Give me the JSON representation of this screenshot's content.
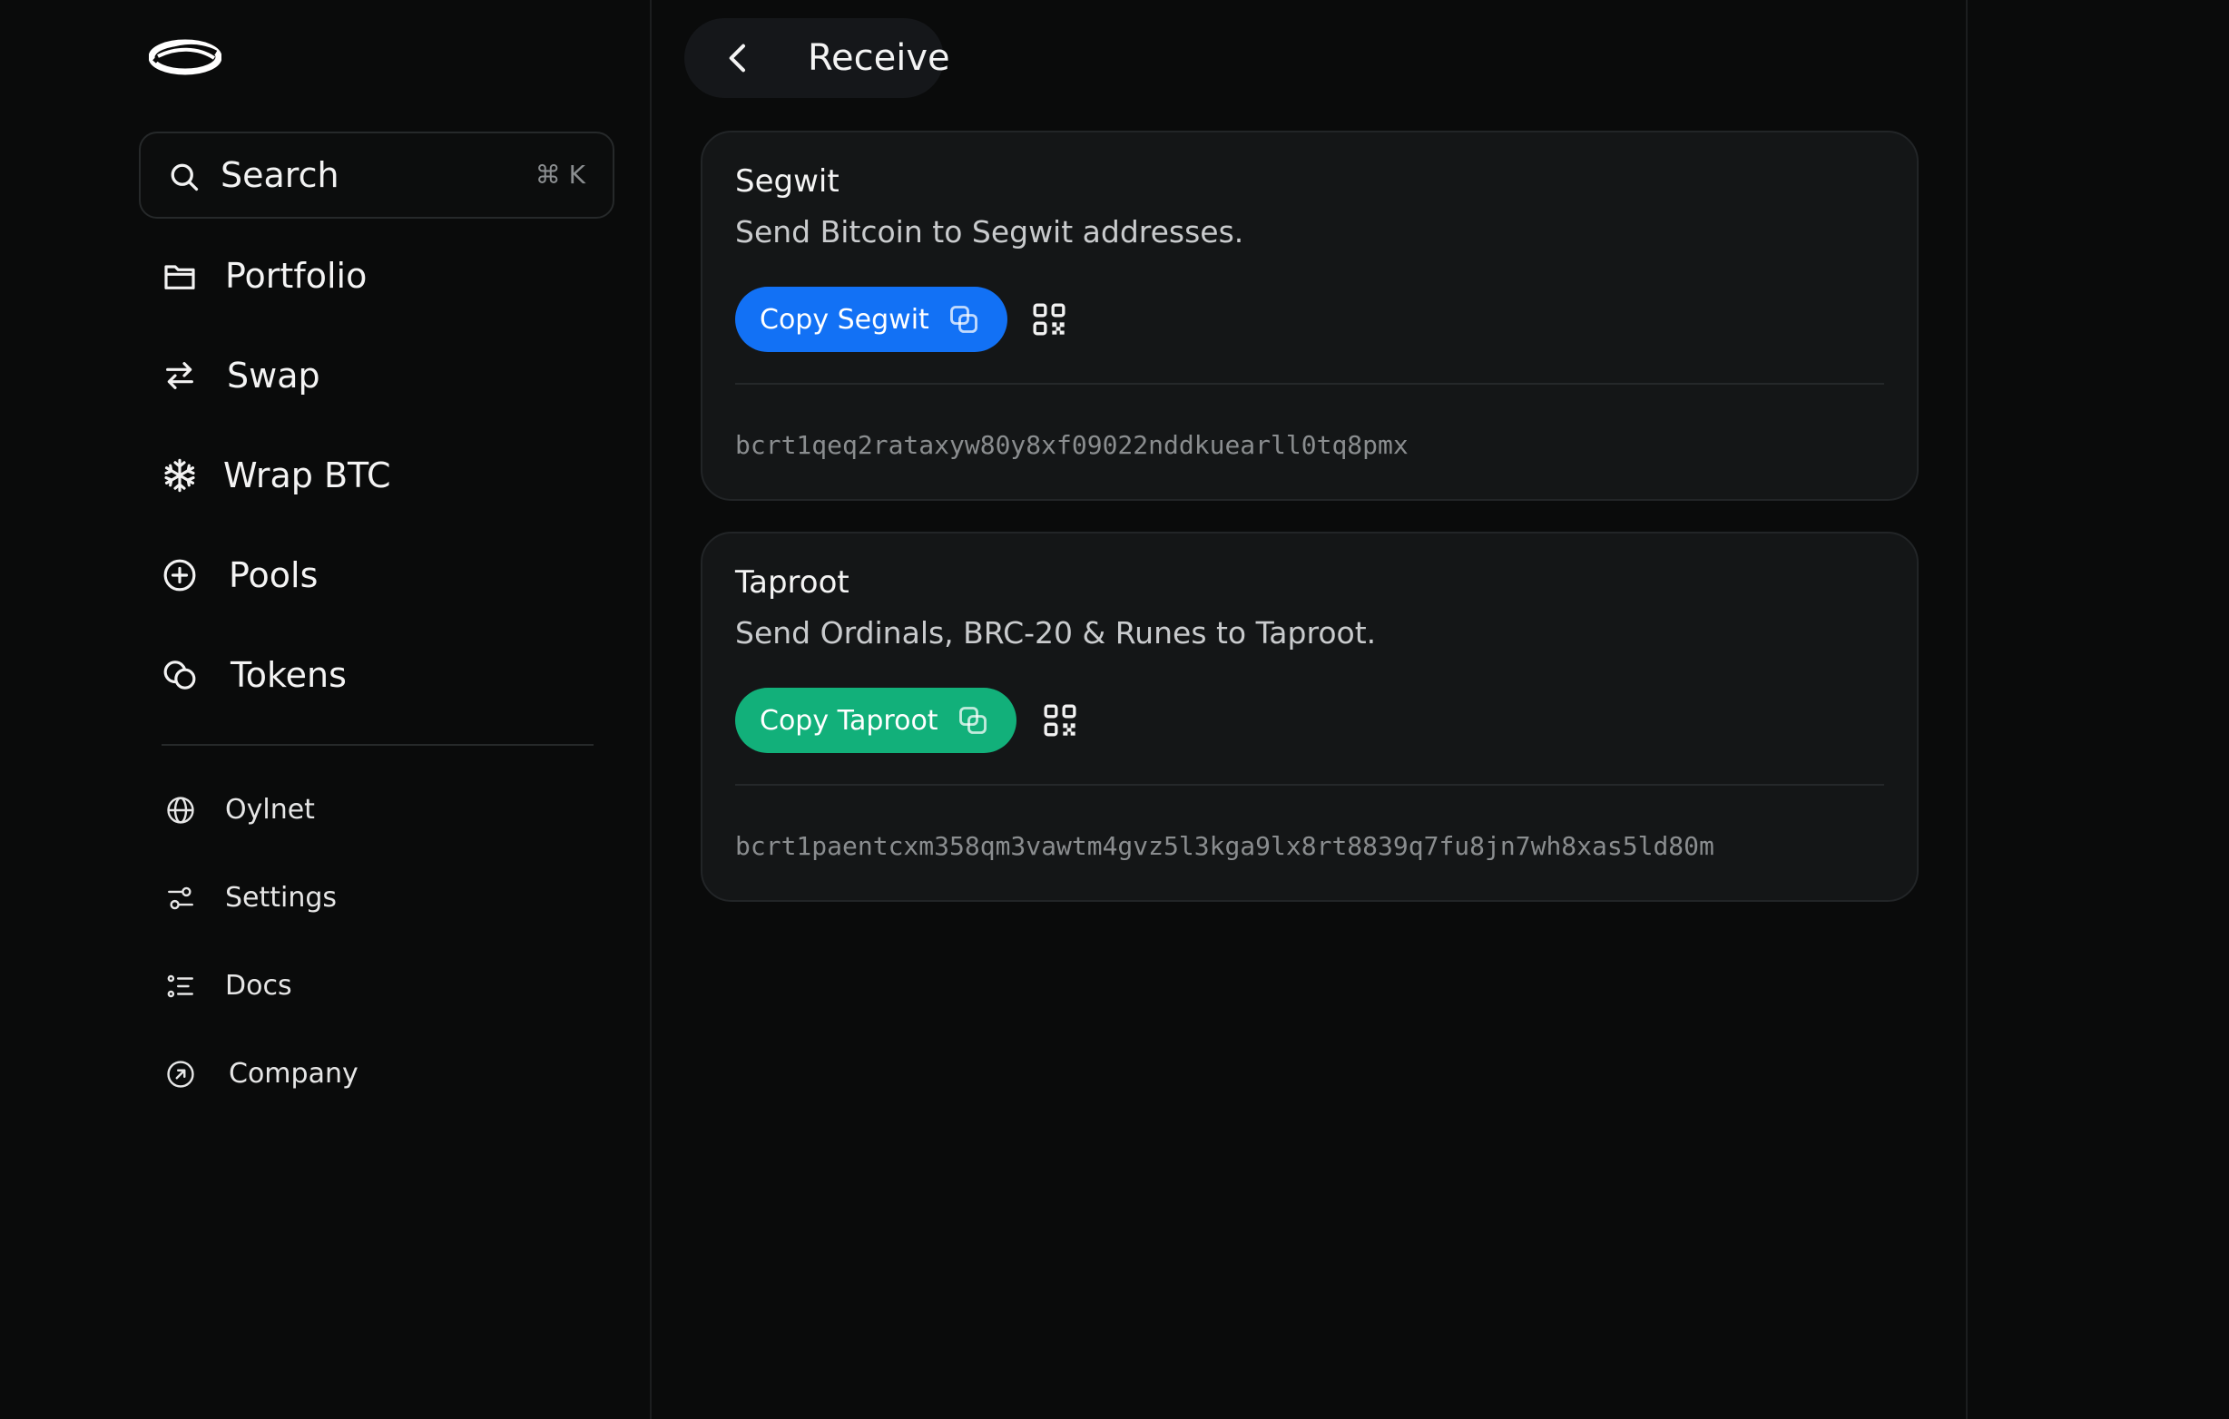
{
  "sidebar": {
    "logo_icon": "orbit-logo-icon",
    "search": {
      "label": "Search",
      "shortcut": "⌘ K",
      "icon": "search-icon"
    },
    "nav": [
      {
        "label": "Portfolio",
        "icon": "folder-icon"
      },
      {
        "label": "Swap",
        "icon": "swap-arrows-icon"
      },
      {
        "label": "Wrap BTC",
        "icon": "snowflake-icon"
      },
      {
        "label": "Pools",
        "icon": "plus-circle-icon"
      },
      {
        "label": "Tokens",
        "icon": "coins-icon"
      }
    ],
    "secondary": [
      {
        "label": "Oylnet",
        "icon": "globe-icon"
      },
      {
        "label": "Settings",
        "icon": "sliders-icon"
      },
      {
        "label": "Docs",
        "icon": "list-icon"
      },
      {
        "label": "Company",
        "icon": "arrow-up-right-circle-icon"
      }
    ]
  },
  "header": {
    "title": "Receive",
    "back_icon": "chevron-left-icon"
  },
  "cards": [
    {
      "title": "Segwit",
      "description": "Send Bitcoin to Segwit addresses.",
      "button_label": "Copy Segwit",
      "button_color": "#1271f5",
      "address": "bcrt1qeq2rataxyw80y8xf09022nddkuearll0tq8pmx"
    },
    {
      "title": "Taproot",
      "description": "Send Ordinals, BRC-20 & Runes to Taproot.",
      "button_label": "Copy Taproot",
      "button_color": "#12b07a",
      "address": "bcrt1paentcxm358qm3vawtm4gvz5l3kga9lx8rt8839q7fu8jn7wh8xas5ld80m"
    }
  ]
}
